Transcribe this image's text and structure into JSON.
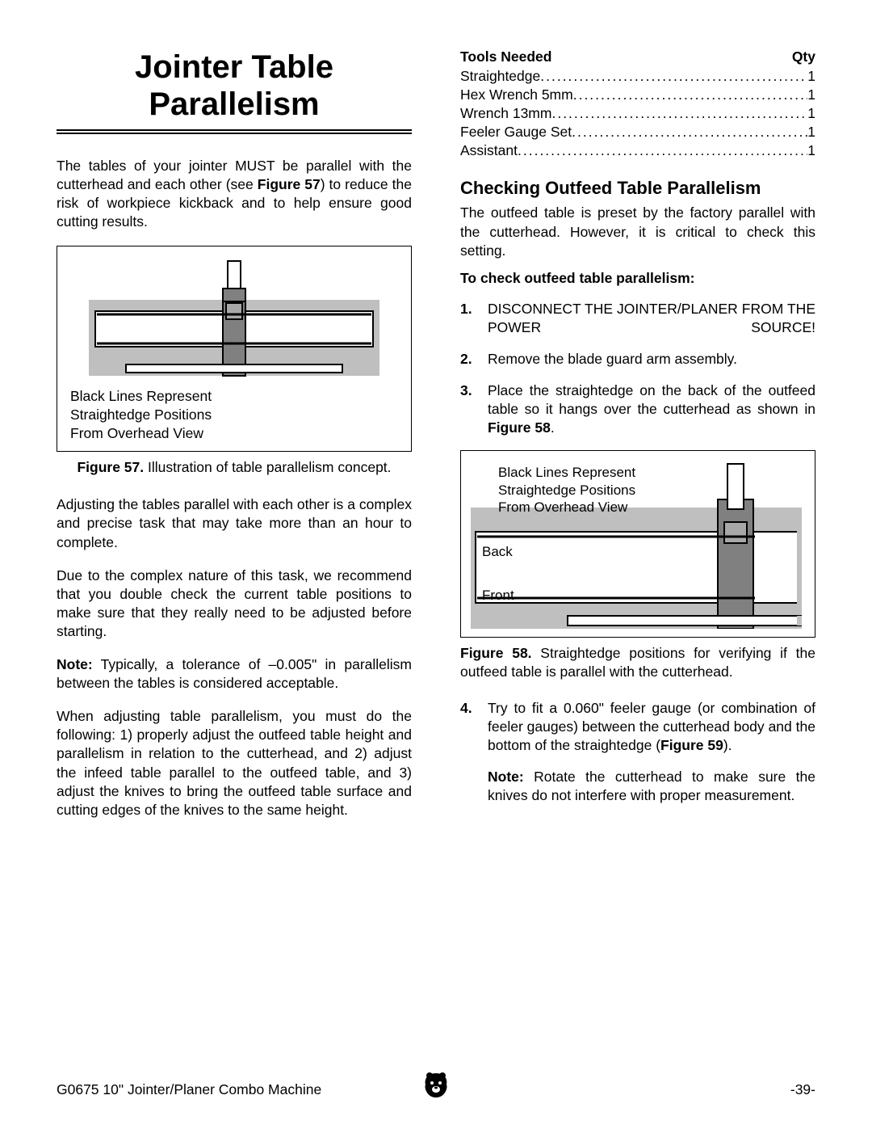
{
  "title_line1": "Jointer Table",
  "title_line2": "Parallelism",
  "intro": "The tables of your jointer MUST be parallel with the cutterhead and each other (see ",
  "intro_fig": "Figure 57",
  "intro_after": ") to reduce the risk of workpiece kickback and to help ensure good cutting results.",
  "fig57_label_l1": "Black Lines Represent",
  "fig57_label_l2": "Straightedge Positions",
  "fig57_label_l3": "From Overhead View",
  "fig57_caption_b": "Figure 57.",
  "fig57_caption": " Illustration of table parallelism concept.",
  "para2": "Adjusting the tables parallel with each other is a complex and precise task that may take more than an hour to complete.",
  "para3": "Due to the complex nature of this task, we recommend that you double check the current table positions to make sure that they really need to be adjusted before starting.",
  "para4_b": "Note:",
  "para4": " Typically, a tolerance of –0.005\" in parallelism between the tables is considered acceptable.",
  "para5": "When adjusting table parallelism, you must do the following: 1) properly adjust the outfeed table height and parallelism in relation to the cutterhead, and 2) adjust the infeed table parallel to the outfeed table, and 3) adjust the knives to bring the outfeed table surface and cutting edges of the knives to the same height.",
  "tools_header": "Tools Needed",
  "qty_header": "Qty",
  "tools": [
    {
      "name": "Straightedge",
      "qty": "1"
    },
    {
      "name": "Hex Wrench 5mm",
      "qty": "1"
    },
    {
      "name": "Wrench 13mm",
      "qty": "1"
    },
    {
      "name": "Feeler Gauge Set",
      "qty": "1"
    },
    {
      "name": "Assistant",
      "qty": "1"
    }
  ],
  "h2": "Checking Outfeed Table Parallelism",
  "h2_sub": "The outfeed table is preset by the factory parallel with the cutterhead. However, it is critical to check this setting.",
  "check_b": "To check outfeed table parallelism:",
  "steps": [
    {
      "n": "1.",
      "body": "DISCONNECT THE JOINTER/PLANER FROM THE POWER SOURCE!"
    },
    {
      "n": "2.",
      "body": "Remove the blade guard arm assembly."
    },
    {
      "n": "3.",
      "body_pre": "Place the straightedge on the back of the outfeed table so it hangs over the cutterhead as shown in ",
      "body_fig": "Figure 58",
      "body_post": "."
    }
  ],
  "fig58_label_l1": "Black Lines Represent",
  "fig58_label_l2": "Straightedge Positions",
  "fig58_label_l3": "From Overhead View",
  "fig58_back": "Back",
  "fig58_front": "Front",
  "fig58_caption_b": "Figure 58.",
  "fig58_caption": " Straightedge positions for verifying if the outfeed table is parallel with the cutterhead.",
  "step4_n": "4.",
  "step4_pre": "Try to fit a 0.060\" feeler gauge (or combination of feeler gauges) between the cutterhead body and the bottom of the straightedge (",
  "step4_fig": "Figure 59",
  "step4_post": ").",
  "step4_note_b": "Note:",
  "step4_note": " Rotate the cutterhead to make sure the knives do not interfere with proper measurement.",
  "footer_left": "G0675 10\" Jointer/Planer Combo Machine",
  "footer_right": "-39-"
}
